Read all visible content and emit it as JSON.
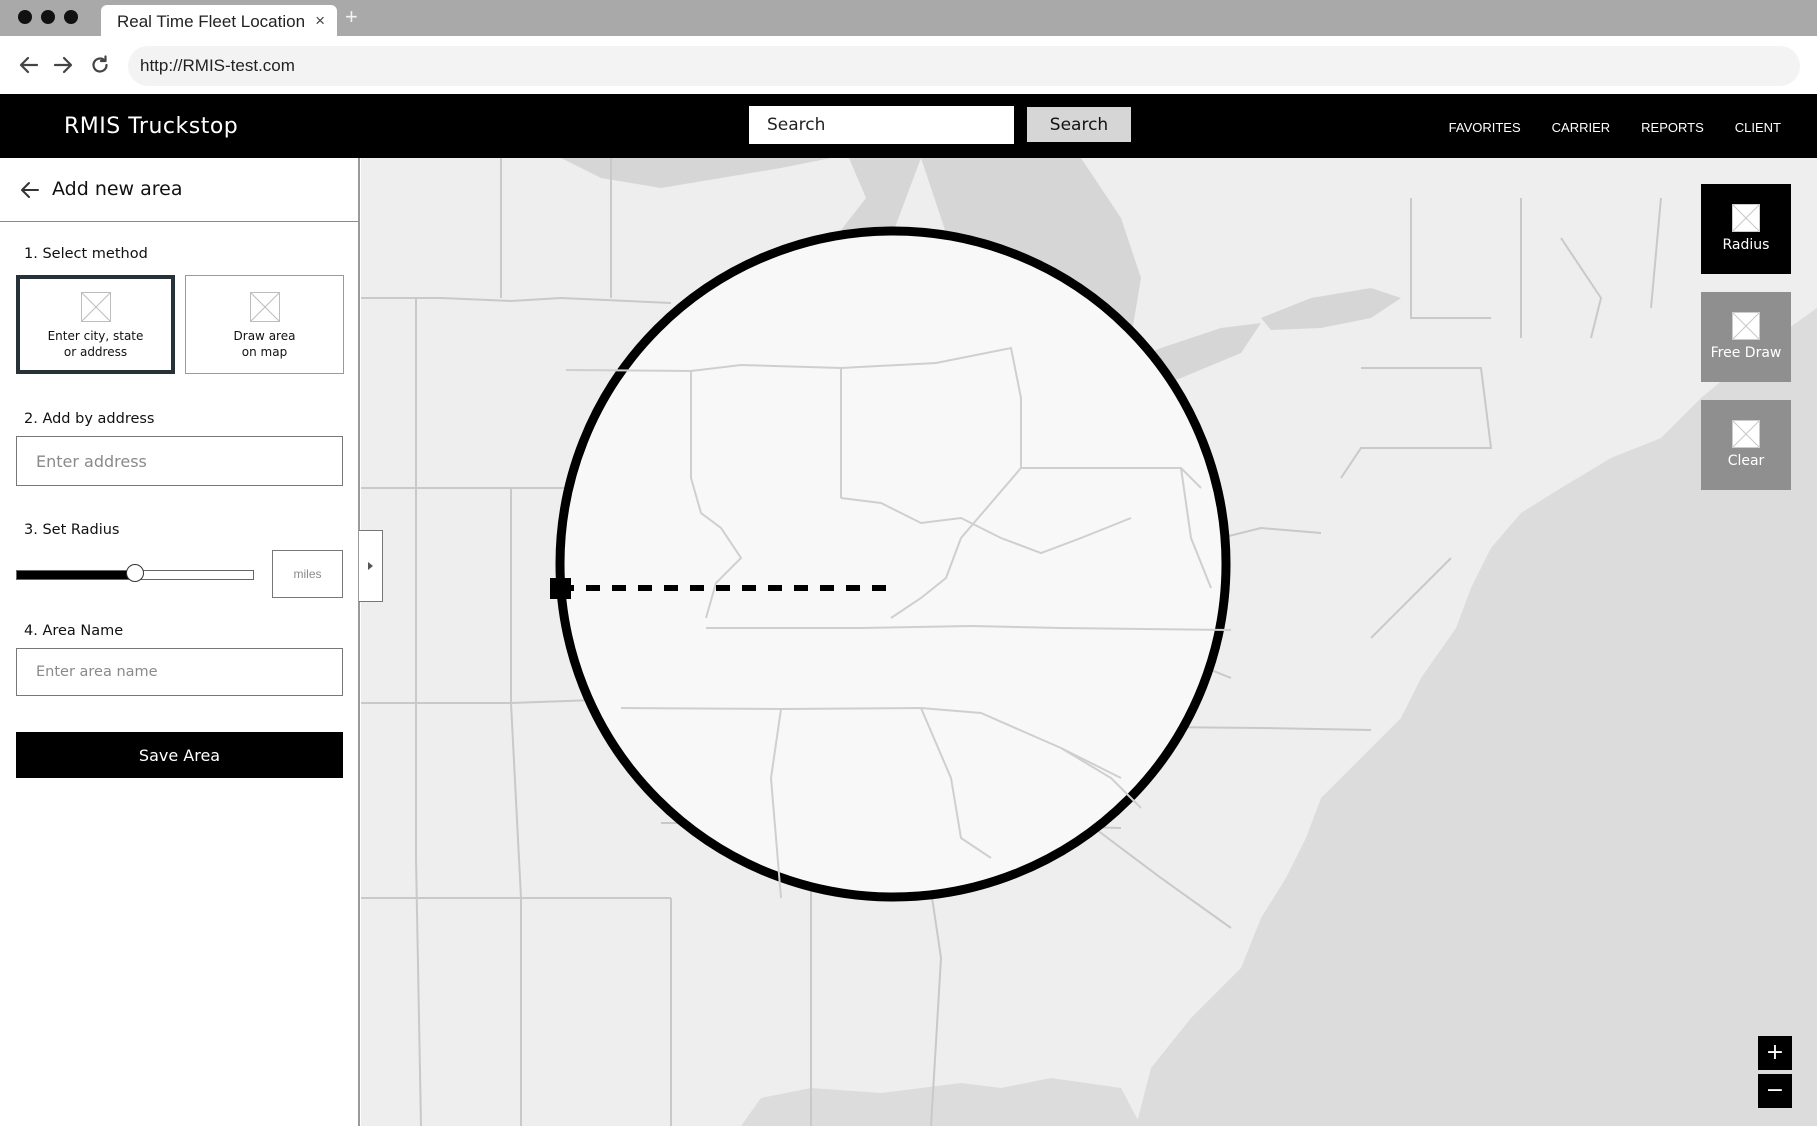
{
  "browser": {
    "tab_title": "Real Time Fleet Location",
    "tab_close": "×",
    "new_tab": "+",
    "url": "http://RMIS-test.com"
  },
  "header": {
    "brand": "RMIS Truckstop",
    "search_placeholder": "Search",
    "search_button": "Search",
    "nav": [
      "FAVORITES",
      "CARRIER",
      "REPORTS",
      "CLIENT"
    ]
  },
  "sidebar": {
    "title": "Add new area",
    "step1": "1. Select method",
    "methods": [
      {
        "label": "Enter city, state\nor address",
        "selected": true
      },
      {
        "label": "Draw area\non map",
        "selected": false
      }
    ],
    "step2": "2. Add by address",
    "address_placeholder": "Enter address",
    "step3": "3. Set Radius",
    "radius_level": 0.5,
    "radius_unit": "miles",
    "step4": "4. Area Name",
    "area_name_placeholder": "Enter area name",
    "save_button": "Save Area"
  },
  "map": {
    "tools": [
      {
        "label": "Radius",
        "active": true
      },
      {
        "label": "Free Draw",
        "active": false
      },
      {
        "label": "Clear",
        "active": false
      }
    ],
    "zoom_in": "+",
    "zoom_out": "−"
  },
  "colors": {
    "header_bg": "#000000",
    "tabbar_bg": "#a9a9a9",
    "map_land": "#eeeeee",
    "map_water": "#dcdcdc",
    "circle_fill": "#f8f8f8",
    "tool_active": "#000000",
    "tool_inactive": "#8f8f8f"
  }
}
